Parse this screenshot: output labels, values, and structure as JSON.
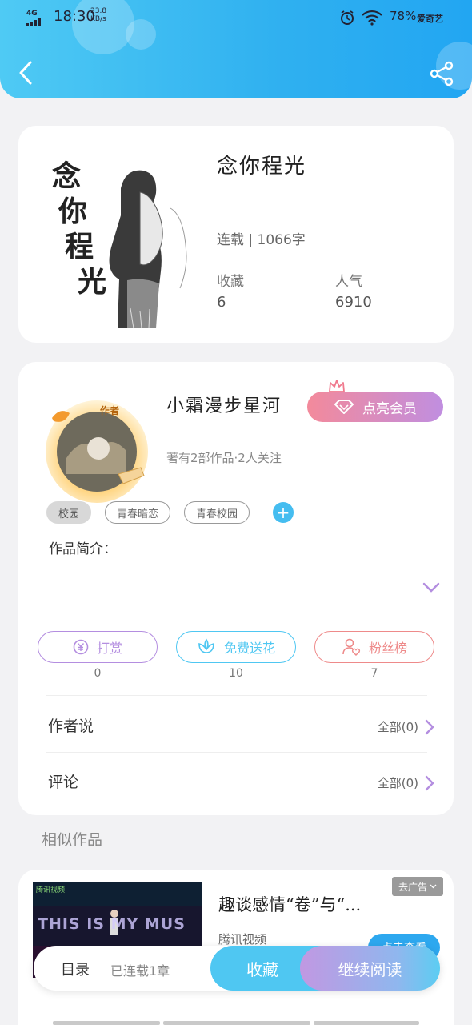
{
  "status_bar": {
    "network": "4G",
    "time": "18:30",
    "speed": "23.8",
    "speed_unit": "KB/s",
    "battery": "78%",
    "carrier": "爱奇艺"
  },
  "book": {
    "title": "念你程光",
    "status": "连载 | 1066字",
    "favorites_label": "收藏",
    "favorites_value": "6",
    "popularity_label": "人气",
    "popularity_value": "6910",
    "cover_text": [
      "念",
      "你",
      "程",
      "光"
    ]
  },
  "author": {
    "badge": "作者",
    "name": "小霜漫步星河",
    "summary": "著有2部作品·2人关注",
    "vip_button": "点亮会员"
  },
  "tags": [
    "校园",
    "青春暗恋",
    "青春校园"
  ],
  "intro_label": "作品简介：",
  "actions": [
    {
      "label": "打赏",
      "count": "0",
      "icon": "yen-icon",
      "color": "#b48ee0"
    },
    {
      "label": "免费送花",
      "count": "10",
      "icon": "flower-icon",
      "color": "#4fc7f2"
    },
    {
      "label": "粉丝榜",
      "count": "7",
      "icon": "fan-icon",
      "color": "#ee8a8a"
    }
  ],
  "rows": [
    {
      "title": "作者说",
      "right": "全部(0)"
    },
    {
      "title": "评论",
      "right": "全部(0)"
    }
  ],
  "similar_title": "相似作品",
  "ad": {
    "title": "趣谈感情“卷”与“...",
    "source": "腾讯视频",
    "close_label": "去广告",
    "cta": "点击查看",
    "thumb_logo": "腾讯视频",
    "thumb_banner": "THIS IS MY MUS"
  },
  "bottom": {
    "toc": "目录",
    "toc_status": "已连载1章",
    "collect": "收藏",
    "continue": "继续阅读"
  },
  "colors": {
    "header": "#2fb0f0",
    "accent_blue": "#4fc7f2",
    "vip_pink": "#f38a9b",
    "purple": "#b48ee0"
  }
}
